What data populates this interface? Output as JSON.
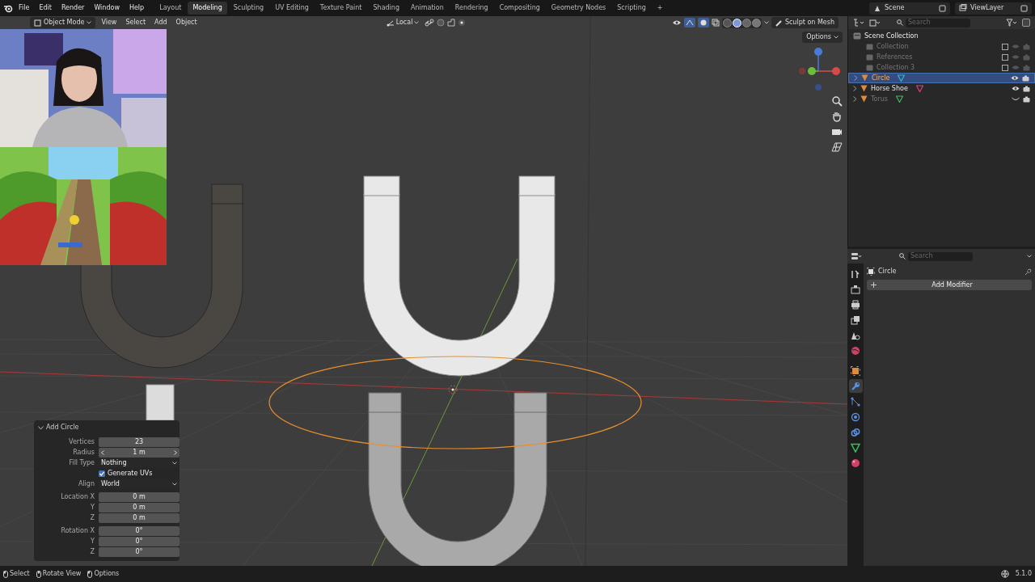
{
  "top_bar": {
    "menus": [
      "File",
      "Edit",
      "Render",
      "Window",
      "Help"
    ],
    "workspaces": [
      {
        "label": "Layout",
        "selected": false
      },
      {
        "label": "Modeling",
        "selected": true
      },
      {
        "label": "Sculpting",
        "selected": false
      },
      {
        "label": "UV Editing",
        "selected": false
      },
      {
        "label": "Texture Paint",
        "selected": false
      },
      {
        "label": "Shading",
        "selected": false
      },
      {
        "label": "Animation",
        "selected": false
      },
      {
        "label": "Rendering",
        "selected": false
      },
      {
        "label": "Compositing",
        "selected": false
      },
      {
        "label": "Geometry Nodes",
        "selected": false
      },
      {
        "label": "Scripting",
        "selected": false
      }
    ],
    "add_workspace": "+",
    "scene": "Scene",
    "view_layer": "ViewLayer"
  },
  "viewport": {
    "mode": "Object Mode",
    "menus": [
      "View",
      "Select",
      "Add",
      "Object"
    ],
    "pivot": "Local",
    "sculpt_button": "Sculpt on Mesh",
    "options": "Options",
    "shading_modes": [
      {
        "selected": false
      },
      {
        "selected": true
      },
      {
        "selected": false
      },
      {
        "selected": false
      }
    ],
    "operator_panel": {
      "title": "Add Circle",
      "expanded": true,
      "fields": [
        {
          "kind": "number",
          "label": "Vertices",
          "value": "23"
        },
        {
          "kind": "slider",
          "label": "Radius",
          "value": "1 m"
        },
        {
          "kind": "dropdown",
          "label": "Fill Type",
          "value": "Nothing"
        },
        {
          "kind": "checkbox",
          "label": "Generate UVs",
          "checked": true
        },
        {
          "kind": "dropdown",
          "label": "Align",
          "value": "World"
        },
        {
          "kind": "number",
          "label": "Location X",
          "value": "0 m",
          "group_start": true
        },
        {
          "kind": "number",
          "label": "Y",
          "value": "0 m"
        },
        {
          "kind": "number",
          "label": "Z",
          "value": "0 m"
        },
        {
          "kind": "number",
          "label": "Rotation X",
          "value": "0°",
          "group_start": true
        },
        {
          "kind": "number",
          "label": "Y",
          "value": "0°"
        },
        {
          "kind": "number",
          "label": "Z",
          "value": "0°"
        }
      ]
    }
  },
  "outliner": {
    "search_placeholder": "Search",
    "root": "Scene Collection",
    "items": [
      {
        "kind": "collection",
        "label": "Collection",
        "enabled": false,
        "selected": false
      },
      {
        "kind": "collection",
        "label": "References",
        "enabled": false,
        "selected": false
      },
      {
        "kind": "collection",
        "label": "Collection 3",
        "enabled": false,
        "selected": false
      },
      {
        "kind": "object",
        "label": "Circle",
        "visible": true,
        "selected": true,
        "color": "#33b5d6"
      },
      {
        "kind": "object",
        "label": "Horse Shoe",
        "visible": true,
        "selected": false,
        "color": "#d6457a"
      },
      {
        "kind": "object",
        "label": "Torus",
        "visible": false,
        "selected": false,
        "color": "#3dbb5c"
      }
    ]
  },
  "properties": {
    "search_placeholder": "Search",
    "object_name": "Circle",
    "add_modifier": "Add Modifier",
    "tabs": [
      {
        "kind": "tool",
        "selected": false
      },
      {
        "kind": "render",
        "selected": false
      },
      {
        "kind": "output",
        "selected": false
      },
      {
        "kind": "view_layer",
        "selected": false
      },
      {
        "kind": "scene",
        "selected": false
      },
      {
        "kind": "world",
        "selected": false
      },
      {
        "kind": "object",
        "selected": false
      },
      {
        "kind": "modifiers",
        "selected": true
      },
      {
        "kind": "particles",
        "selected": false
      },
      {
        "kind": "physics",
        "selected": false
      },
      {
        "kind": "constraints",
        "selected": false
      },
      {
        "kind": "data",
        "selected": false
      },
      {
        "kind": "material",
        "selected": false
      }
    ]
  },
  "status_bar": {
    "hints": [
      "Select",
      "Rotate View",
      "Options"
    ],
    "version": "5.1.0"
  }
}
